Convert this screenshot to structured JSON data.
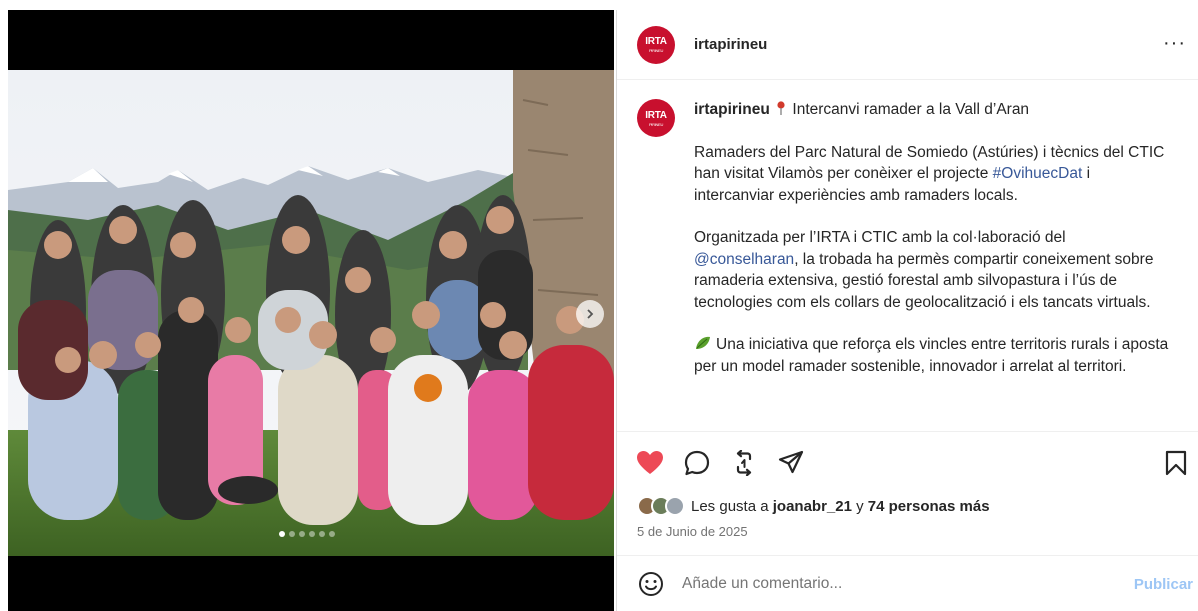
{
  "post": {
    "username": "irtapirineu",
    "avatar_text": "IRTA",
    "avatar_subtext": "PIRINEU",
    "more_label": "···"
  },
  "caption": {
    "username": "irtapirineu",
    "title": "Intercanvi ramader a la Vall d’Aran",
    "p1_a": "Ramaders del Parc Natural de Somiedo (Astúries) i tècnics del CTIC han visitat Vilamòs per conèixer el projecte ",
    "p1_link": "#OvihuecDat",
    "p1_b": " i intercanviar experiències amb ramaders locals.",
    "p2_a": "Organitzada per l’IRTA i CTIC amb la col·laboració del ",
    "p2_link": "@conselharan",
    "p2_b": ", la trobada ha permès compartir coneixement sobre ramaderia extensiva, gestió forestal amb silvopastura i l’ús de tecnologies com els collars de geolocalització i els tancats virtuals.",
    "p3": "Una iniciativa que reforça els vincles entre territoris rurals i aposta per un model ramader sostenible, innovador i arrelat al territori."
  },
  "actions": {
    "like_icon": "heart-filled-icon",
    "comment_icon": "comment-icon",
    "repost_icon": "repost-icon",
    "share_icon": "share-icon",
    "save_icon": "bookmark-icon",
    "like_color": "#ed4956"
  },
  "likes": {
    "prefix": "Les gusta a ",
    "user": "joanabr_21",
    "middle": " y ",
    "others": "74 personas más"
  },
  "date": "5 de Junio de 2025",
  "comment": {
    "placeholder": "Añade un comentario...",
    "publish_label": "Publicar"
  },
  "carousel": {
    "total_dots": 6,
    "active_index": 0
  },
  "colors": {
    "brand": "#c8102e",
    "link": "#385898",
    "publish_disabled": "#9dc6f5"
  }
}
